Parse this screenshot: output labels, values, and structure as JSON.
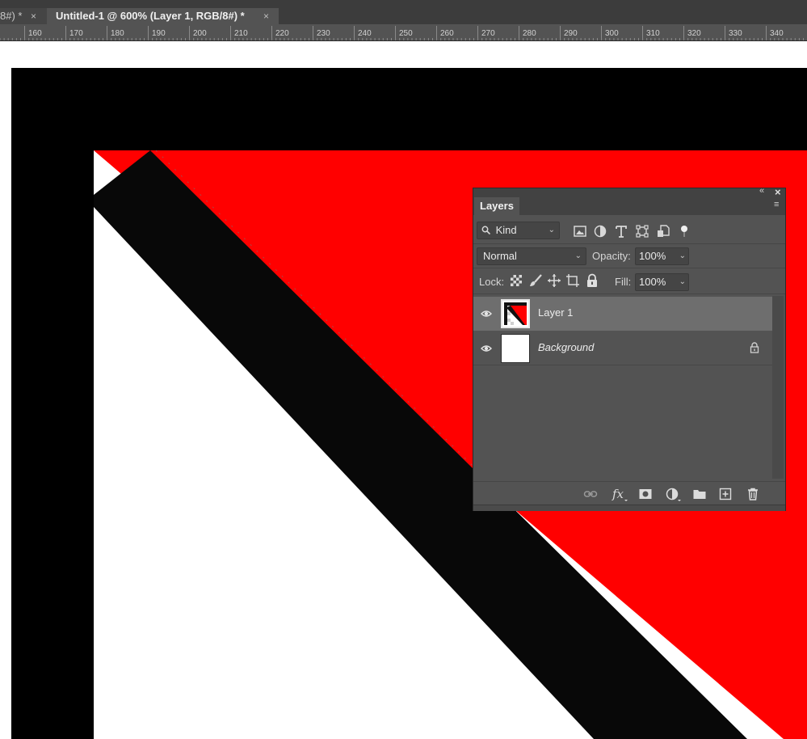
{
  "tabs": [
    {
      "label": "8#) *",
      "active": false
    },
    {
      "label": "Untitled-1 @ 600% (Layer 1, RGB/8#) *",
      "active": true
    }
  ],
  "tab_close_glyph": "×",
  "ruler": {
    "ticks": [
      "160",
      "170",
      "180",
      "190",
      "200",
      "210",
      "220",
      "230",
      "240",
      "250",
      "260",
      "270",
      "280",
      "290",
      "300",
      "310",
      "320",
      "330",
      "340"
    ]
  },
  "canvas": {
    "colors": {
      "background_fill": "#000000",
      "layer_red": "#ff0000",
      "white": "#ffffff",
      "stripe": "#080808"
    }
  },
  "layers_panel": {
    "title": "Layers",
    "collapse_glyph": "«",
    "close_glyph": "×",
    "menu_glyph": "≡",
    "filter": {
      "label": "Kind",
      "icons": [
        "image-filter-icon",
        "adjustment-filter-icon",
        "type-filter-icon",
        "shape-filter-icon",
        "smart-object-filter-icon",
        "filter-toggle-icon"
      ]
    },
    "blend_mode": "Normal",
    "opacity_label": "Opacity:",
    "opacity_value": "100%",
    "lock_label": "Lock:",
    "fill_label": "Fill:",
    "fill_value": "100%",
    "layers": [
      {
        "name": "Layer 1",
        "visible": true,
        "selected": true,
        "locked": false
      },
      {
        "name": "Background",
        "visible": true,
        "selected": false,
        "locked": true
      }
    ],
    "footer_icons": [
      "link-layers-icon",
      "fx-icon",
      "add-mask-icon",
      "adjustment-layer-icon",
      "new-group-icon",
      "new-layer-icon",
      "delete-layer-icon"
    ]
  }
}
